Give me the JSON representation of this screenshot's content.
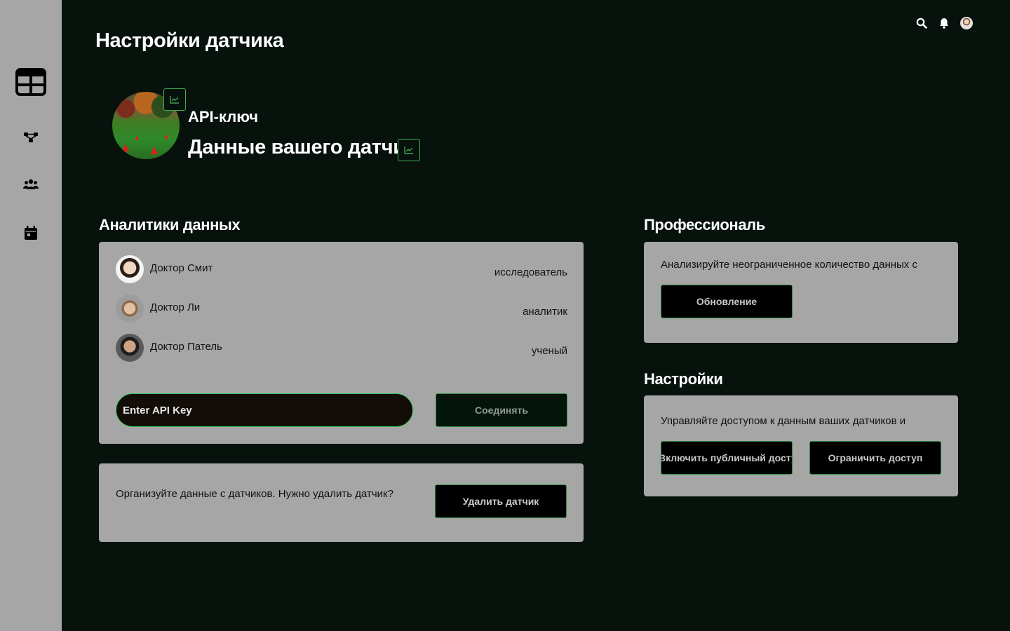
{
  "header": {
    "page_title": "Настройки датчика"
  },
  "profile": {
    "api_label": "API-ключ",
    "sensor_title": "Данные вашего датчи"
  },
  "analytics": {
    "title": "Аналитики данных",
    "members": [
      {
        "name": "Доктор Смит",
        "role": "исследователь"
      },
      {
        "name": "Доктор Ли",
        "role": "аналитик"
      },
      {
        "name": "Доктор Патель",
        "role": "ученый"
      }
    ],
    "api_input_placeholder": "Enter API Key",
    "connect_label": "Соединять"
  },
  "delete_card": {
    "text": "Организуйте данные с датчиков. Нужно удалить датчик?",
    "delete_label": "Удалить датчик"
  },
  "pro": {
    "title": "Профессиональ",
    "text": "Анализируйте неограниченное количество данных с",
    "upgrade_label": "Обновление"
  },
  "settings": {
    "title": "Настройки",
    "text": "Управляйте доступом к данным ваших датчиков и",
    "public_access_label": "Включить публичный доступ",
    "restrict_access_label": "Ограничить доступ"
  },
  "icons": {
    "sidebar": [
      "dashboard-grid-icon",
      "network-icon",
      "users-icon",
      "calendar-icon"
    ],
    "topbar": [
      "search-icon",
      "bell-icon",
      "user-avatar"
    ],
    "badges": [
      "chart-line-icon",
      "chart-line-icon"
    ]
  },
  "colors": {
    "background": "#07120d",
    "sidebar": "#a6a6a6",
    "card": "#a6a6a6",
    "accent_border": "#37c15a",
    "button_bg": "#000000"
  }
}
